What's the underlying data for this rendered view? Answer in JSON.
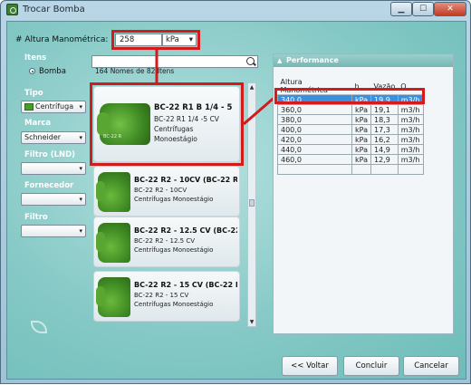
{
  "window": {
    "title": "Trocar Bomba",
    "minimize_glyph": "▁",
    "maximize_glyph": "☐",
    "close_glyph": "✕",
    "icon": "pump-app-icon"
  },
  "altura": {
    "label": "# Altura Manométrica:",
    "value": "258",
    "unit": "kPa",
    "dropdown_glyph": "▾"
  },
  "filters": {
    "itens_label": "Itens",
    "itens_radio": "Bomba",
    "tipo_label": "Tipo",
    "tipo_value": "Centrífuga",
    "marca_label": "Marca",
    "marca_value": "Schneider",
    "filtro_lnd_label": "Filtro (LND)",
    "filtro_lnd_value": "",
    "fornecedor_label": "Fornecedor",
    "fornecedor_value": "",
    "filtro_label": "Filtro",
    "filtro_value": "",
    "dropdown_glyph": "▾"
  },
  "search": {
    "value": "",
    "count_text": "164 Nomes de 82 Itens"
  },
  "highlight_card": {
    "title": "BC-22 R1 B 1/4 - 5",
    "line1": "BC-22 R1 1/4 -5 CV",
    "line2": "Centrífugas",
    "line3": "Monoestágio",
    "img_tag": "BC-22 R"
  },
  "cards": [
    {
      "title": "BC-22 R2 - 10CV (BC-22 R2",
      "line1": "BC-22 R2 - 10CV",
      "line2": "Centrífugas Monoestágio"
    },
    {
      "title": "BC-22 R2 - 12.5 CV (BC-22 R",
      "line1": "BC-22 R2 - 12.5 CV",
      "line2": "Centrífugas Monoestágio"
    },
    {
      "title": "BC-22 R2 - 15 CV (BC-22 R2",
      "line1": "BC-22 R2 - 15 CV",
      "line2": "Centrífugas Monoestágio"
    }
  ],
  "scroll": {
    "up_glyph": "▲",
    "down_glyph": "▼"
  },
  "performance": {
    "title": "Performance",
    "collapse_glyph": "▲",
    "headers": [
      "Altura Manométrica",
      "h",
      "Vazão",
      "Q"
    ],
    "rows": [
      [
        "340,0",
        "kPa",
        "19,9",
        "m3/h"
      ],
      [
        "360,0",
        "kPa",
        "19,1",
        "m3/h"
      ],
      [
        "380,0",
        "kPa",
        "18,3",
        "m3/h"
      ],
      [
        "400,0",
        "kPa",
        "17,3",
        "m3/h"
      ],
      [
        "420,0",
        "kPa",
        "16,2",
        "m3/h"
      ],
      [
        "440,0",
        "kPa",
        "14,9",
        "m3/h"
      ],
      [
        "460,0",
        "kPa",
        "12,9",
        "m3/h"
      ]
    ]
  },
  "buttons": {
    "back": "<< Voltar",
    "finish": "Concluir",
    "cancel": "Cancelar"
  },
  "colors": {
    "highlight_red": "#d21c1c",
    "selection_blue": "#3b8fe0",
    "background_teal": "#86c9c6"
  }
}
